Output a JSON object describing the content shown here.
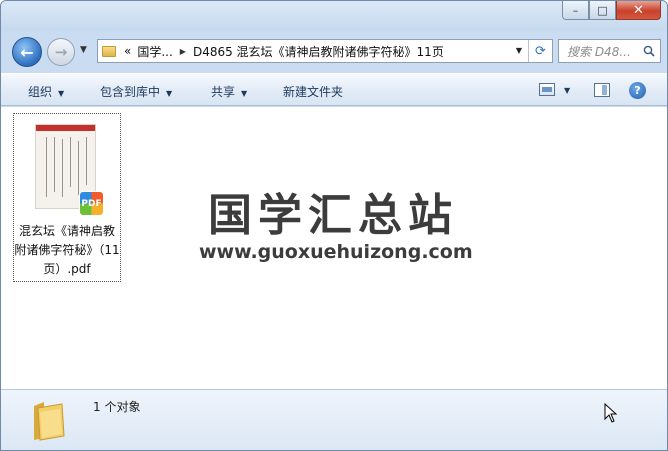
{
  "window": {
    "caption_buttons": {
      "minimize": "–",
      "maximize": "□",
      "close": "✕"
    }
  },
  "nav": {
    "back_icon": "back-arrow-icon",
    "forward_icon": "forward-arrow-icon",
    "breadcrumb": {
      "overflow": "«",
      "parent": "国学...",
      "current": "D4865 混玄坛《请神启教附诸佛字符秘》11页"
    },
    "search_placeholder": "搜索 D48..."
  },
  "toolbar": {
    "organize": "组织",
    "include_in_library": "包含到库中",
    "share": "共享",
    "new_folder": "新建文件夹"
  },
  "content": {
    "files": [
      {
        "name": "混玄坛《请神启教附诸佛字符秘》（11页）.pdf",
        "badge": "PDF",
        "icon": "pdf-file-icon"
      }
    ],
    "watermark": {
      "title": "国学汇总站",
      "url": "www.guoxuehuizong.com"
    }
  },
  "status": {
    "count_text": "1 个对象"
  },
  "colors": {
    "titlebar": "#c6d9ee",
    "toolbar_text": "#1e395b",
    "close_button": "#c9412b",
    "watermark": "#3c3c3c"
  }
}
